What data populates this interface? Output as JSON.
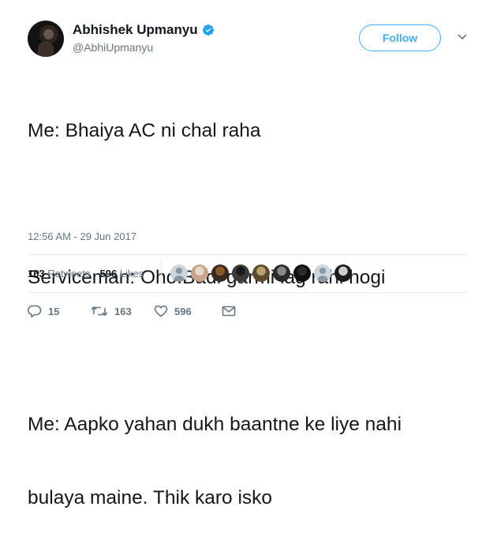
{
  "tweet": {
    "author": {
      "display_name": "Abhishek Upmanyu",
      "handle": "@AbhiUpmanyu",
      "verified": true
    },
    "follow_label": "Follow",
    "lines": [
      "Me: Bhaiya AC ni chal raha",
      "",
      "Serviceman: Oho.Badi garmi lag rahi hogi",
      "",
      "Me: Aapko yahan dukh baantne ke liye nahi",
      "bulaya maine. Thik karo isko"
    ],
    "timestamp": "12:56 AM - 29 Jun 2017",
    "stats": {
      "retweets_count": "163",
      "retweets_label": "Retweets",
      "likes_count": "596",
      "likes_label": "Likes"
    },
    "likers": [
      {
        "kind": "default"
      },
      {
        "kind": "photo",
        "colors": [
          "#e8d6c6",
          "#c8a48a"
        ]
      },
      {
        "kind": "photo",
        "colors": [
          "#8b5a2b",
          "#3a2a1e"
        ]
      },
      {
        "kind": "photo",
        "colors": [
          "#1a1a1a",
          "#3a3a3a"
        ]
      },
      {
        "kind": "photo",
        "colors": [
          "#b8a070",
          "#5e4b2a"
        ]
      },
      {
        "kind": "photo",
        "colors": [
          "#8a8a8a",
          "#2a2a2a"
        ]
      },
      {
        "kind": "photo",
        "colors": [
          "#2b2b2b",
          "#0f0f0f"
        ]
      },
      {
        "kind": "default"
      },
      {
        "kind": "photo",
        "colors": [
          "#cfcfcf",
          "#1c1c1c"
        ]
      }
    ],
    "actions": {
      "replies": "15",
      "retweets": "163",
      "likes": "596"
    },
    "colors": {
      "accent": "#1da1f2",
      "text": "#14171a",
      "secondary": "#657786",
      "divider": "#e6ecf0"
    }
  }
}
